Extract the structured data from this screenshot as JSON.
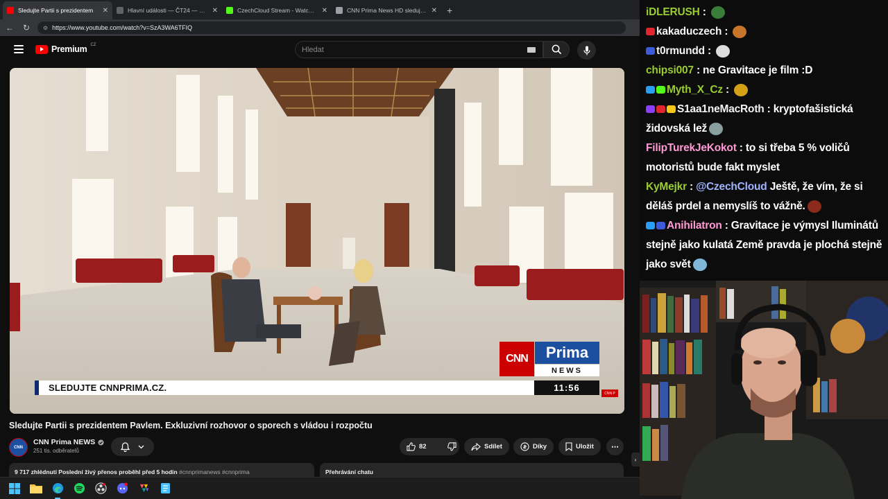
{
  "browser": {
    "tabs": [
      {
        "label": "Sledujte Partii s prezidentem",
        "favicon_color": "#ff0000",
        "active": true
      },
      {
        "label": "Hlavní události — ČT24 — Česká",
        "favicon_color": "#5f6368",
        "active": false
      },
      {
        "label": "CzechCloud Stream - Watch Live",
        "favicon_color": "#53fc18",
        "active": false
      },
      {
        "label": "CNN Prima News HD sledujte onl",
        "favicon_color": "#9aa0a6",
        "active": false
      }
    ],
    "url": "https://www.youtube.com/watch?v=SzA3WA6TFIQ"
  },
  "youtube": {
    "logo_text": "Premium",
    "logo_region": "CZ",
    "search_placeholder": "Hledat"
  },
  "video": {
    "banner_text": "SLEDUJTE CNNPRIMA.CZ.",
    "clock": "11:56",
    "logo_cnn": "CNN",
    "logo_prima": "Prima",
    "logo_news": "NEWS",
    "title": "Sledujte Partii s prezidentem Pavlem. Exkluzivní rozhovor o sporech s vládou i rozpočtu"
  },
  "channel": {
    "name": "CNN Prima NEWS",
    "subscribers": "251 tis. odběratelů",
    "verified": true
  },
  "actions": {
    "likes": "82",
    "share": "Sdílet",
    "thanks": "Díky",
    "save": "Uložit"
  },
  "description": {
    "stats": "9 717 zhlédnutí  Poslední živý přenos proběhl před 5 hodin",
    "tags": "#cnnprimanews #cnnprima"
  },
  "chat_replay_label": "Přehrávání chatu",
  "taskbar": {
    "icons": [
      "windows-start",
      "file-explorer",
      "edge",
      "spotify",
      "obs",
      "discord",
      "app-multicolor",
      "notepad"
    ]
  },
  "chat": {
    "messages": [
      {
        "user": "iDLERUSH",
        "color": "#9acd32",
        "badges": [],
        "text": "",
        "emote_color": "#3a7d3a"
      },
      {
        "user": "kakaduczech",
        "color": "#f4f4f4",
        "badges": [
          "#e0262f"
        ],
        "text": "",
        "emote_color": "#c7752a"
      },
      {
        "user": "t0rmundd",
        "color": "#f4f4f4",
        "badges": [
          "#3c5bd9"
        ],
        "text": "",
        "emote_color": "#dddddd"
      },
      {
        "user": "chipsi007",
        "color": "#9acd32",
        "badges": [],
        "text": "ne Gravitace je film :D",
        "emote_color": ""
      },
      {
        "user": "Myth_X_Cz",
        "color": "#9acd32",
        "badges": [
          "#2a9df4",
          "#53fc18"
        ],
        "text": "",
        "emote_color": "#d4a017"
      },
      {
        "user": "S1aa1neMacRoth",
        "color": "#f4f4f4",
        "badges": [
          "#8a3ffc",
          "#e0262f",
          "#f5c518"
        ],
        "text": "kryptofašistická židovská lež",
        "emote_color": "#8aa0a0"
      },
      {
        "user": "FilipTurekJeKokot",
        "color": "#ff9ad5",
        "badges": [],
        "text": "to si třeba 5 % voličů motoristů bude fakt myslet",
        "emote_color": ""
      },
      {
        "user": "KyMejkr",
        "color": "#9acd32",
        "badges": [],
        "mention": "@CzechCloud",
        "text": "Ještě, že vím, že si děláš prdel a nemyslíš to vážně.",
        "emote_color": "#8b2b1b"
      },
      {
        "user": "Anihilatron",
        "color": "#ff9ad5",
        "badges": [
          "#2a9df4",
          "#3c5bd9"
        ],
        "text": "Gravitace je výmysl Iluminátů stejně jako kulatá Země pravda je plochá stejně jako svět",
        "emote_color": "#7fb7d9"
      }
    ]
  }
}
